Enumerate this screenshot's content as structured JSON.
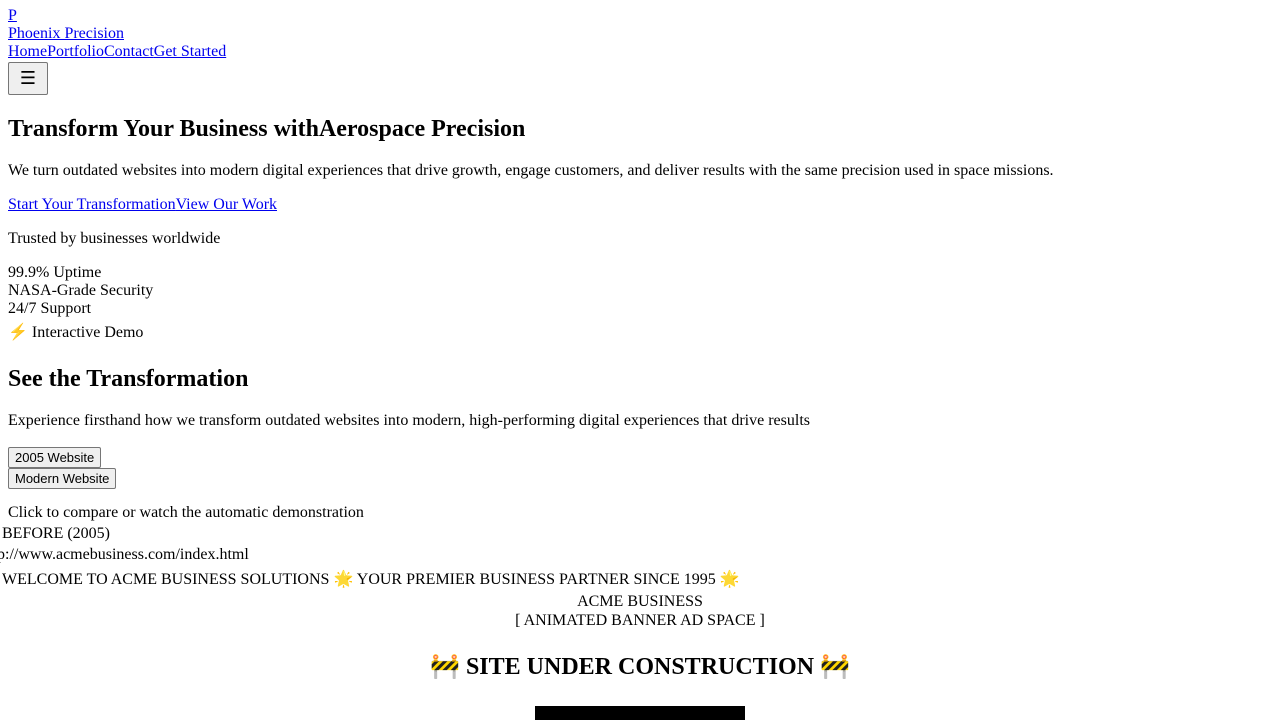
{
  "header": {
    "logo_letter": "P",
    "brand_name": "Phoenix Precision",
    "nav": [
      "Home",
      "Portfolio",
      "Contact",
      "Get Started"
    ],
    "menu_icon": "hamburger-menu-icon"
  },
  "hero": {
    "title_part1": "Transform Your Business with",
    "title_part2": "Aerospace Precision",
    "subtitle": "We turn outdated websites into modern digital experiences that drive growth, engage customers, and deliver results with the same precision used in space missions.",
    "cta_primary": "Start Your Transformation",
    "cta_secondary": "View Our Work",
    "trust_text": "Trusted by businesses worldwide",
    "stats": [
      "99.9% Uptime",
      "NASA-Grade Security",
      "24/7 Support"
    ]
  },
  "demo": {
    "badge_icon": "⚡",
    "badge_label": "Interactive Demo",
    "title": "See the Transformation",
    "description": "Experience firsthand how we transform outdated websites into modern, high-performing digital experiences that drive results",
    "toggle_old": "2005 Website",
    "toggle_new": "Modern Website",
    "hint": "Click to compare or watch the automatic demonstration",
    "before_label": "BEFORE (2005)",
    "address_bar": "p://www.acmebusiness.com/index.html"
  },
  "legacy_site": {
    "marquee": "WELCOME TO ACME BUSINESS SOLUTIONS 🌟 YOUR PREMIER BUSINESS PARTNER SINCE 1995 🌟",
    "company": "ACME BUSINESS",
    "banner_ad": "[ ANIMATED BANNER AD SPACE ]",
    "construction": "🚧 SITE UNDER CONSTRUCTION 🚧"
  }
}
